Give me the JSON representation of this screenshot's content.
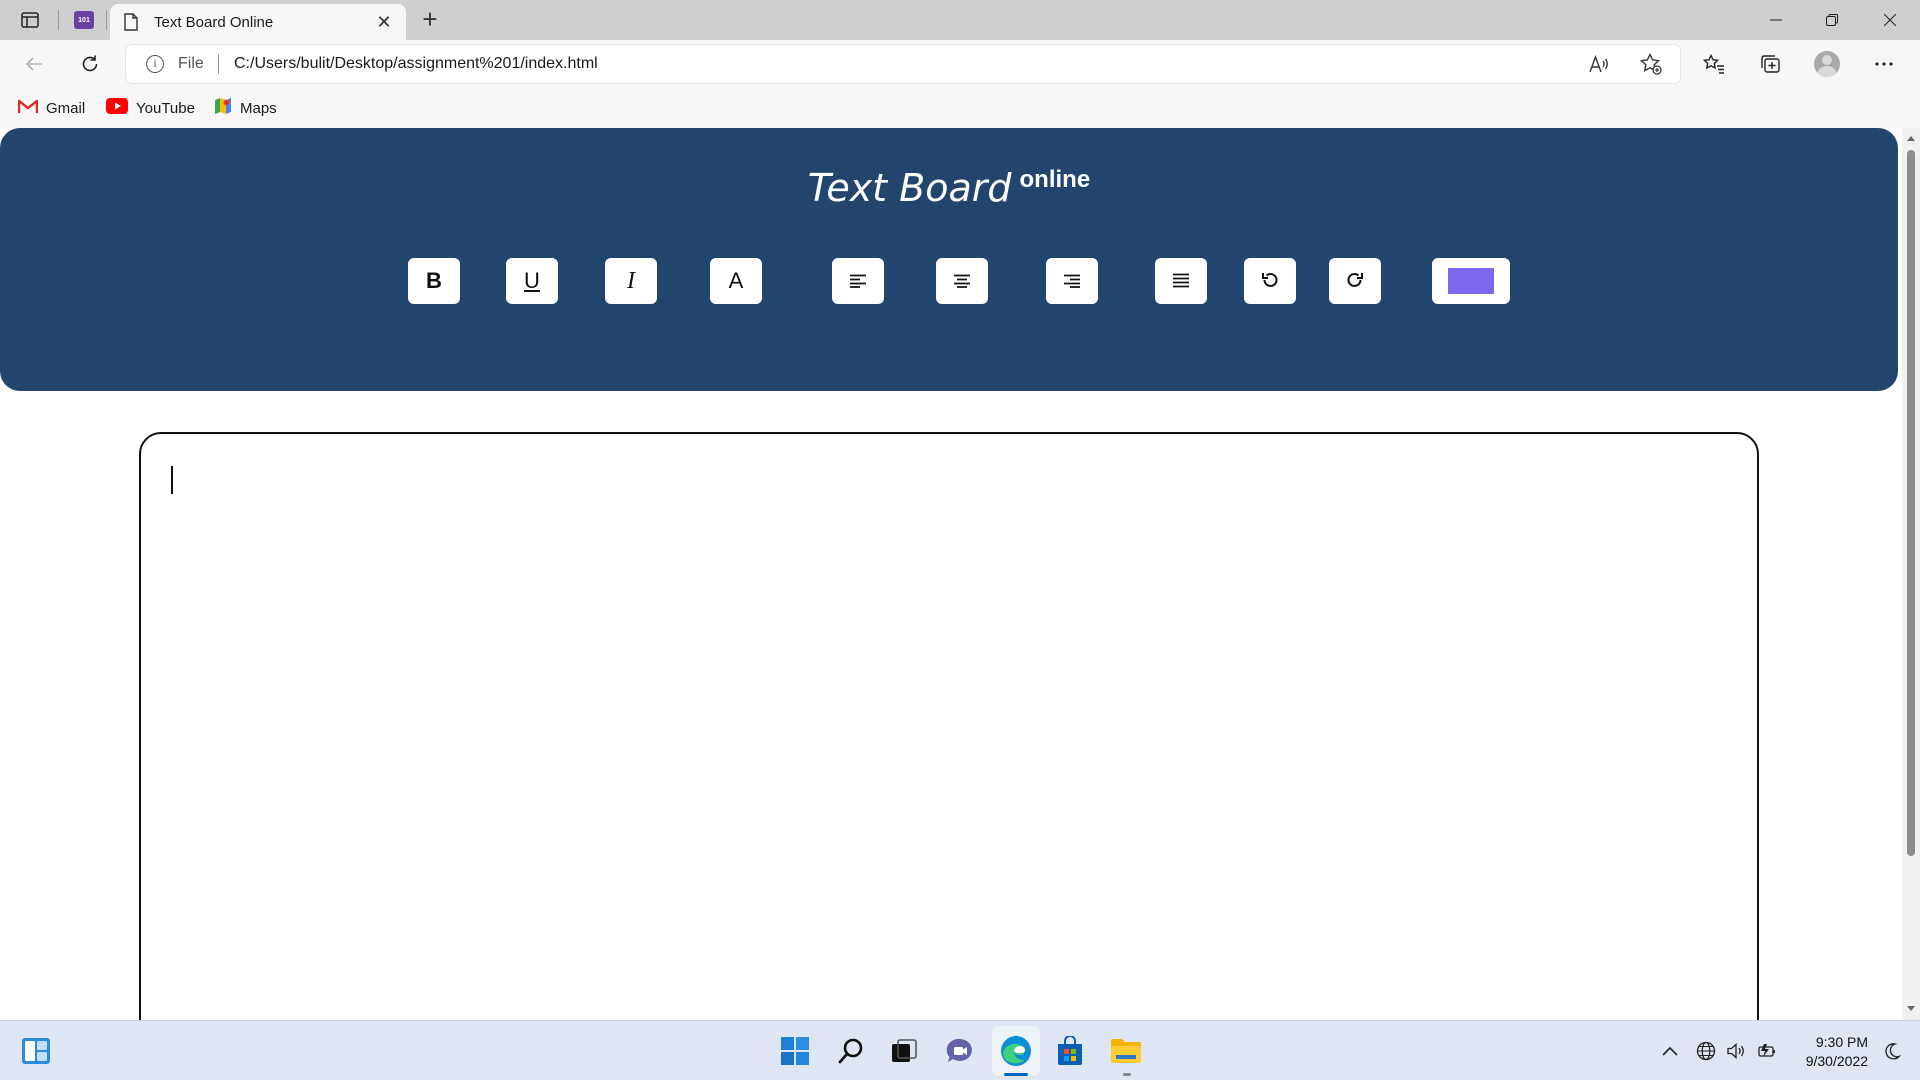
{
  "browser": {
    "tab": {
      "title": "Text Board Online",
      "close": "✕"
    },
    "pinned_tab_badge": "101",
    "new_tab": "+",
    "address": {
      "scheme_label": "File",
      "url": "C:/Users/bulit/Desktop/assignment%201/index.html"
    },
    "bookmarks": [
      {
        "label": "Gmail"
      },
      {
        "label": "YouTube"
      },
      {
        "label": "Maps"
      }
    ]
  },
  "app": {
    "title": "Text Board",
    "title_suffix": "online",
    "toolbar": {
      "bold": "B",
      "underline": "U",
      "italic": "I",
      "font_color": "A"
    },
    "color_picker": {
      "value": "#7b68ee"
    }
  },
  "editor": {
    "content": ""
  },
  "taskbar": {
    "time": "9:30 PM",
    "date": "9/30/2022"
  },
  "colors": {
    "header_bg": "#22456e",
    "accent": "#0067c0"
  }
}
